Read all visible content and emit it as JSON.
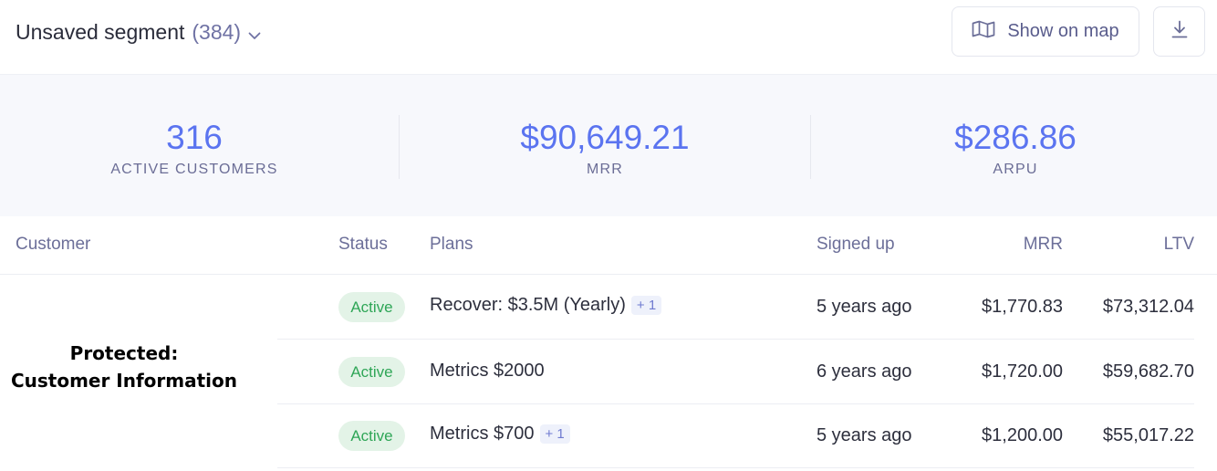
{
  "header": {
    "title": "Unsaved segment",
    "count": "(384)",
    "show_on_map_label": "Show on map"
  },
  "stats": [
    {
      "value": "316",
      "label": "ACTIVE CUSTOMERS"
    },
    {
      "value": "$90,649.21",
      "label": "MRR"
    },
    {
      "value": "$286.86",
      "label": "ARPU"
    }
  ],
  "table": {
    "columns": [
      "Customer",
      "Status",
      "Plans",
      "Signed up",
      "MRR",
      "LTV"
    ],
    "rows": [
      {
        "status": "Active",
        "plan": "Recover: $3.5M (Yearly)",
        "extra": "+ 1",
        "signed_up": "5 years ago",
        "mrr": "$1,770.83",
        "ltv": "$73,312.04"
      },
      {
        "status": "Active",
        "plan": "Metrics $2000",
        "extra": "",
        "signed_up": "6 years ago",
        "mrr": "$1,720.00",
        "ltv": "$59,682.70"
      },
      {
        "status": "Active",
        "plan": "Metrics $700",
        "extra": "+ 1",
        "signed_up": "5 years ago",
        "mrr": "$1,200.00",
        "ltv": "$55,017.22"
      }
    ],
    "redaction": [
      "Protected:",
      "Customer Information"
    ]
  },
  "colors": {
    "accent": "#5b74f0",
    "status_active_bg": "#e3f3e7",
    "status_active_text": "#2fa657",
    "stats_bg": "#f7f8fc"
  },
  "icons": {
    "title_dropdown": "chevron-down-icon",
    "map_button": "map-icon",
    "export_button": "download-icon"
  }
}
